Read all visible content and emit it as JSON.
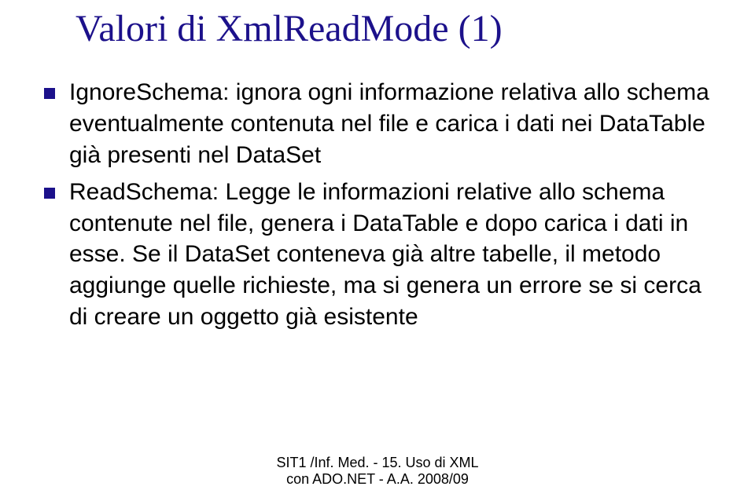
{
  "title": "Valori di XmlReadMode (1)",
  "bullets": [
    "IgnoreSchema: ignora ogni informazione relativa allo schema eventualmente contenuta nel file e carica i dati nei DataTable già presenti nel DataSet",
    "ReadSchema: Legge le informazioni relative allo schema contenute nel file, genera i DataTable e dopo carica i dati in esse. Se il DataSet conteneva già altre tabelle, il metodo aggiunge quelle richieste, ma si genera un errore se si cerca di creare un oggetto già esistente"
  ],
  "footer": {
    "line1": "SIT1 /Inf. Med. - 15. Uso di XML",
    "line2": "con ADO.NET - A.A. 2008/09"
  }
}
